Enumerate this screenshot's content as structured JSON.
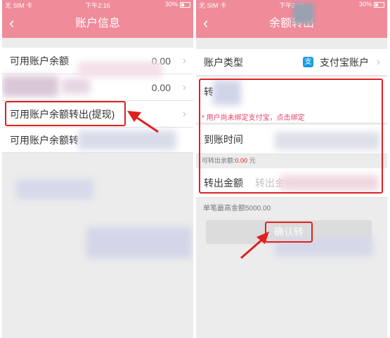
{
  "colors": {
    "brand": "#f08b99",
    "highlight": "#e02020",
    "alipay": "#1a9ae8"
  },
  "status": {
    "carrier": "无 SIM 卡",
    "time": "下午2:16",
    "battery": "30%"
  },
  "left": {
    "title": "账户信息",
    "back_icon": "back-chevron-icon",
    "rows": [
      {
        "label": "可用账户余额",
        "value": "0.00"
      },
      {
        "label": "",
        "value": "0.00"
      },
      {
        "label": "可用账户余额转出(提现)",
        "value": ""
      },
      {
        "label": "可用账户余额转",
        "value": ""
      }
    ]
  },
  "right": {
    "title": "余额转出",
    "back_icon": "back-chevron-icon",
    "account_type_label": "账户类型",
    "account_type_value": "支付宝账户",
    "bind_hint": "* 用户尚未绑定支付宝，点击绑定",
    "arrival_time_label": "到账时间",
    "transferable_label": "可转出余额:",
    "transferable_amount": "0.00",
    "transferable_unit": "元",
    "transfer_amount_label": "转出金额",
    "transfer_amount_placeholder": "转出金",
    "max_amount_note": "单笔最高金额5000.00",
    "confirm_button": "确认转"
  }
}
